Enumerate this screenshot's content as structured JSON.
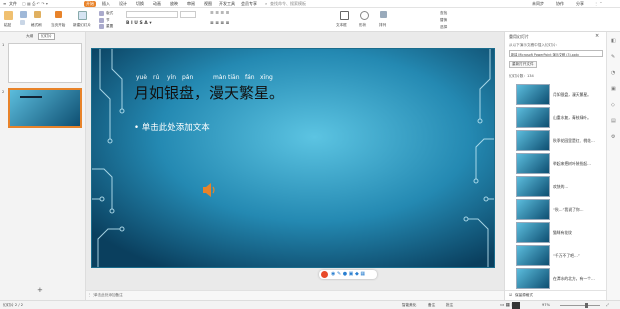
{
  "menu": {
    "file": "文件",
    "tab_active": "开始",
    "insert": "插入",
    "design": "设计",
    "transition": "切换",
    "animation": "动画",
    "slideshow": "放映",
    "review": "审阅",
    "view": "视图",
    "developer": "开发工具",
    "member": "会员专享",
    "search_placeholder": "查找命令、搜索模板",
    "unsync": "未同步",
    "collab": "协作",
    "share": "分享"
  },
  "ribbon": {
    "paste": "粘贴",
    "format_painter": "格式刷",
    "slide_from_start": "当页开始",
    "new_slide": "新建幻灯片",
    "layout": "版式",
    "section": "节",
    "reset": "重置",
    "textbox": "文本框",
    "shape": "形状",
    "arrange": "排列",
    "find": "查找",
    "replace": "替换",
    "select": "选择"
  },
  "left_pane": {
    "tab_outline": "大纲",
    "tab_slides": "幻灯片",
    "add": "+",
    "slide_numbers": [
      "1",
      "2"
    ]
  },
  "slide": {
    "pinyin": [
      "yuè",
      "rú",
      "yín",
      "pán",
      "màn",
      "tiān",
      "fán",
      "xīng"
    ],
    "title": "月如银盘，漫天繁星。",
    "bullet": "单击此处添加文本",
    "speaker_icon": "speaker-icon"
  },
  "notes": {
    "placeholder": "单击此处添加备注"
  },
  "right_pane": {
    "title": "重用幻灯片",
    "hint": "从以下演示文稿中插入幻灯片：",
    "file_combo": "新建 Microsoft PowerPoint 演示文稿 (3).pptx",
    "browse": "浏览",
    "open_file": "重新打开文件",
    "count_label": "幻灯片数：134",
    "items": [
      "月如银盘，漫天繁星。",
      "山重水复，青枝绿叶。",
      "秋季花园里是红、桃花…",
      "举起来把树叶装扮起…",
      "欢快的…",
      "“秋…”我说了你…",
      "猫咪有花纹",
      "“千万不了吧…”",
      "在潭水的北方，有一个…",
      "这些、那是最美的…"
    ],
    "keep_format": "保留源格式"
  },
  "status": {
    "slide_info": "幻灯片 2 / 2",
    "theme": "Office 主题",
    "smart_beautify": "智能美化",
    "notes_btn": "备注",
    "comment_btn": "批注",
    "zoom": "97%"
  },
  "colors": {
    "accent": "#e8832a",
    "slide_dark": "#0b4a6b",
    "slide_light": "#4fb6d8"
  }
}
